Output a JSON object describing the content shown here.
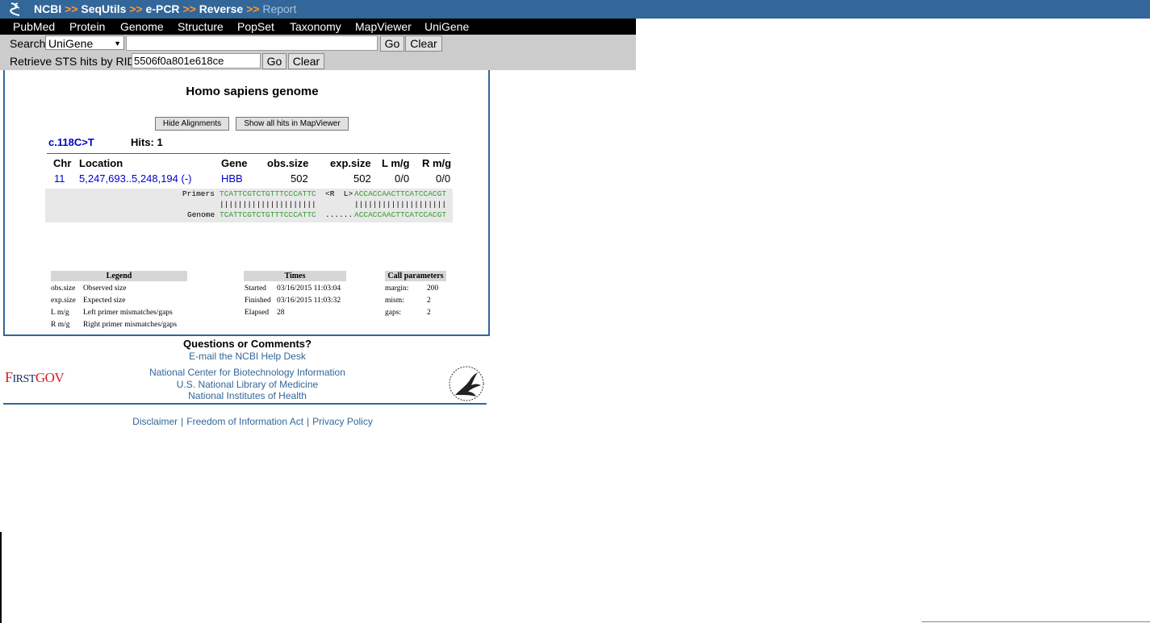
{
  "breadcrumb": {
    "items": [
      "NCBI",
      "SeqUtils",
      "e-PCR",
      "Reverse"
    ],
    "current": "Report",
    "separator": ">>"
  },
  "nav": [
    "PubMed",
    "Protein",
    "Genome",
    "Structure",
    "PopSet",
    "Taxonomy",
    "MapViewer",
    "UniGene"
  ],
  "search": {
    "label": "Search",
    "db": "UniGene",
    "query": "",
    "go": "Go",
    "clear": "Clear"
  },
  "rid": {
    "label": "Retrieve STS hits by RID:",
    "value": "5506f0a801e618ce",
    "go": "Go",
    "clear": "Clear"
  },
  "report": {
    "title": "Homo sapiens genome",
    "hide_btn": "Hide Alignments",
    "show_btn": "Show all hits in MapViewer",
    "sts_name": "c.118C>T",
    "hits_label": "Hits: 1",
    "columns": [
      "Chr",
      "Location",
      "Gene",
      "obs.size",
      "exp.size",
      "L m/g",
      "R m/g"
    ],
    "row": {
      "chr": "11",
      "location": "5,247,693..5,248,194 (-)",
      "gene": "HBB",
      "obs_size": "502",
      "exp_size": "502",
      "lmg": "0/0",
      "rmg": "0/0"
    },
    "alignment": {
      "primers_label": "Primers",
      "primer_left": "TCATTCGTCTGTTTCCCATTC",
      "mid": "<R  L>",
      "primer_right": "ACCACCAACTTCATCCACGT",
      "bars_left": "|||||||||||||||||||||",
      "bars_right": "||||||||||||||||||||",
      "genome_label": "Genome",
      "genome_left": "TCATTCGTCTGTTTCCCATTC",
      "genome_mid": "......",
      "genome_right": "ACCACCAACTTCATCCACGT"
    }
  },
  "legend": {
    "title": "Legend",
    "rows": [
      [
        "obs.size",
        "Observed size"
      ],
      [
        "exp.size",
        "Expected size"
      ],
      [
        "L m/g",
        "Left primer mismatches/gaps"
      ],
      [
        "R m/g",
        "Right primer mismatches/gaps"
      ]
    ]
  },
  "times": {
    "title": "Times",
    "rows": [
      [
        "Started",
        "03/16/2015 11:03:04"
      ],
      [
        "Finished",
        "03/16/2015 11:03:32"
      ],
      [
        "Elapsed",
        "28"
      ]
    ]
  },
  "params": {
    "title": "Call parameters",
    "rows": [
      [
        "margin:",
        "200"
      ],
      [
        "mism:",
        "2"
      ],
      [
        "gaps:",
        "2"
      ]
    ]
  },
  "footer": {
    "question": "Questions or Comments?",
    "email": "E-mail the NCBI Help Desk",
    "org1": "National Center for Biotechnology Information",
    "org2": "U.S. National Library of Medicine",
    "org3": "National Institutes of Health",
    "firstgov_first": "F",
    "firstgov_irst": "IRST",
    "firstgov_gov": "GOV",
    "links": [
      "Disclaimer",
      "Freedom of Information Act",
      "Privacy Policy"
    ]
  },
  "colors": {
    "brand": "#336699",
    "separator": "#ff9933",
    "link": "#0000cc",
    "sequence": "#339933"
  }
}
